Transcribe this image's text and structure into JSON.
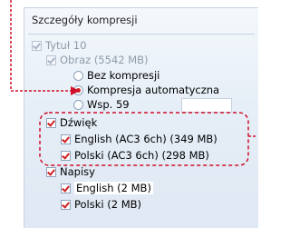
{
  "panel": {
    "title": "Szczegóły kompresji"
  },
  "tree": {
    "title_label": "Tytuł 10",
    "image_label": "Obraz (5542 MB)",
    "no_compression": "Bez kompresji",
    "auto_compression": "Kompresja automatyczna",
    "coefficient": "Wsp. 59",
    "audio_label": "Dźwięk",
    "audio_en": "English (AC3 6ch) (349 MB)",
    "audio_pl": "Polski (AC3 6ch) (298 MB)",
    "subs_label": "Napisy",
    "subs_en": "English (2 MB)",
    "subs_pl": "Polski (2 MB)"
  },
  "colors": {
    "annotation": "#d0102a",
    "check": "#d02020"
  }
}
